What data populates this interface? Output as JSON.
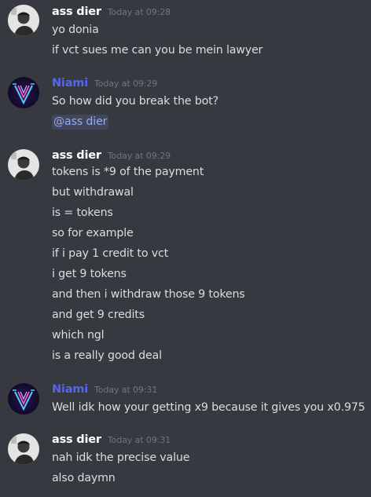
{
  "colors": {
    "background": "#36393f",
    "user_ass_dier": "#ffffff",
    "user_niami": "#5865f2",
    "text": "#dcddde",
    "timestamp": "#72767d",
    "mention_text": "#99aaf0"
  },
  "messages": [
    {
      "author": "ass dier",
      "timestamp": "Today at 09:28",
      "avatar_icon": "person-photo-avatar-icon",
      "lines": [
        "yo donia",
        "if vct sues me can you be mein lawyer"
      ]
    },
    {
      "author": "Niami",
      "timestamp": "Today at 09:29",
      "avatar_icon": "neon-v-logo-avatar-icon",
      "lines": [
        "So how did you break the bot?"
      ],
      "mention": "@ass dier"
    },
    {
      "author": "ass dier",
      "timestamp": "Today at 09:29",
      "avatar_icon": "person-photo-avatar-icon",
      "lines": [
        "tokens is *9 of the payment",
        "but withdrawal",
        "is = tokens",
        "so for example",
        "if i pay 1 credit to vct",
        "i get 9 tokens",
        "and then i withdraw those 9 tokens",
        "and get 9 credits",
        "which ngl",
        "is a really good deal"
      ]
    },
    {
      "author": "Niami",
      "timestamp": "Today at 09:31",
      "avatar_icon": "neon-v-logo-avatar-icon",
      "lines": [
        "Well idk how your getting x9 because it gives you x0.975"
      ]
    },
    {
      "author": "ass dier",
      "timestamp": "Today at 09:31",
      "avatar_icon": "person-photo-avatar-icon",
      "lines": [
        "nah idk the precise value",
        "also daymn"
      ]
    }
  ]
}
